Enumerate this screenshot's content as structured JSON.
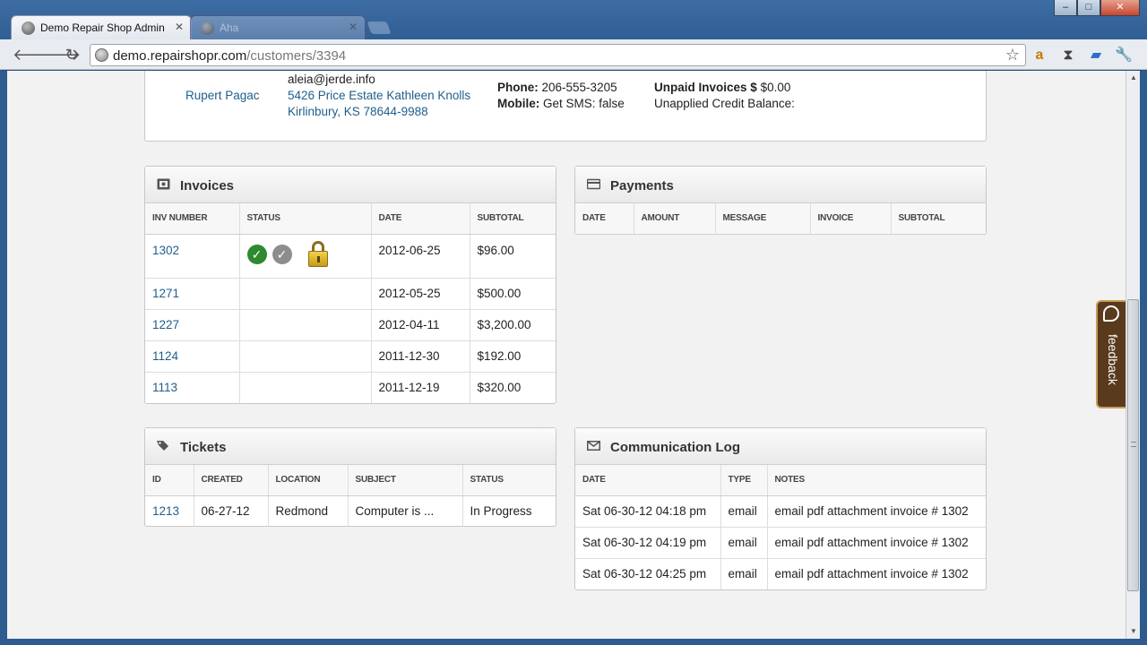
{
  "browser": {
    "tabs": [
      {
        "title": "Demo Repair Shop Admin",
        "active": true
      },
      {
        "title": "Aha",
        "active": false
      }
    ],
    "url_host": "demo.repairshopr.com",
    "url_path": "/customers/3394",
    "window_controls": {
      "minimize": "–",
      "maximize": "□",
      "close": "✕"
    }
  },
  "customer": {
    "name": "Rupert Pagac",
    "email": "aleia@jerde.info",
    "address_line1": "5426 Price Estate Kathleen Knolls",
    "address_line2": "Kirlinbury, KS 78644-9988",
    "phone_label": "Phone:",
    "phone": "206-555-3205",
    "mobile_label": "Mobile:",
    "mobile": "Get SMS: false",
    "unpaid_label": "Unpaid Invoices $",
    "unpaid_value": "$0.00",
    "unapplied_label": "Unapplied Credit Balance:"
  },
  "invoices": {
    "title": "Invoices",
    "columns": [
      "INV NUMBER",
      "STATUS",
      "DATE",
      "SUBTOTAL"
    ],
    "rows": [
      {
        "number": "1302",
        "date": "2012-06-25",
        "subtotal": "$96.00"
      },
      {
        "number": "1271",
        "date": "2012-05-25",
        "subtotal": "$500.00"
      },
      {
        "number": "1227",
        "date": "2012-04-11",
        "subtotal": "$3,200.00"
      },
      {
        "number": "1124",
        "date": "2011-12-30",
        "subtotal": "$192.00"
      },
      {
        "number": "1113",
        "date": "2011-12-19",
        "subtotal": "$320.00"
      }
    ]
  },
  "payments": {
    "title": "Payments",
    "columns": [
      "DATE",
      "AMOUNT",
      "MESSAGE",
      "INVOICE",
      "SUBTOTAL"
    ]
  },
  "tickets": {
    "title": "Tickets",
    "columns": [
      "ID",
      "CREATED",
      "LOCATION",
      "SUBJECT",
      "STATUS"
    ],
    "rows": [
      {
        "id": "1213",
        "created": "06-27-12",
        "location": "Redmond",
        "subject": "Computer is ...",
        "status": "In Progress"
      }
    ]
  },
  "comm_log": {
    "title": "Communication Log",
    "columns": [
      "DATE",
      "TYPE",
      "NOTES"
    ],
    "rows": [
      {
        "date": "Sat 06-30-12 04:18 pm",
        "type": "email",
        "notes": "email pdf attachment invoice # 1302"
      },
      {
        "date": "Sat 06-30-12 04:19 pm",
        "type": "email",
        "notes": "email pdf attachment invoice # 1302"
      },
      {
        "date": "Sat 06-30-12 04:25 pm",
        "type": "email",
        "notes": "email pdf attachment invoice # 1302"
      }
    ]
  },
  "feedback": {
    "label": "feedback"
  }
}
